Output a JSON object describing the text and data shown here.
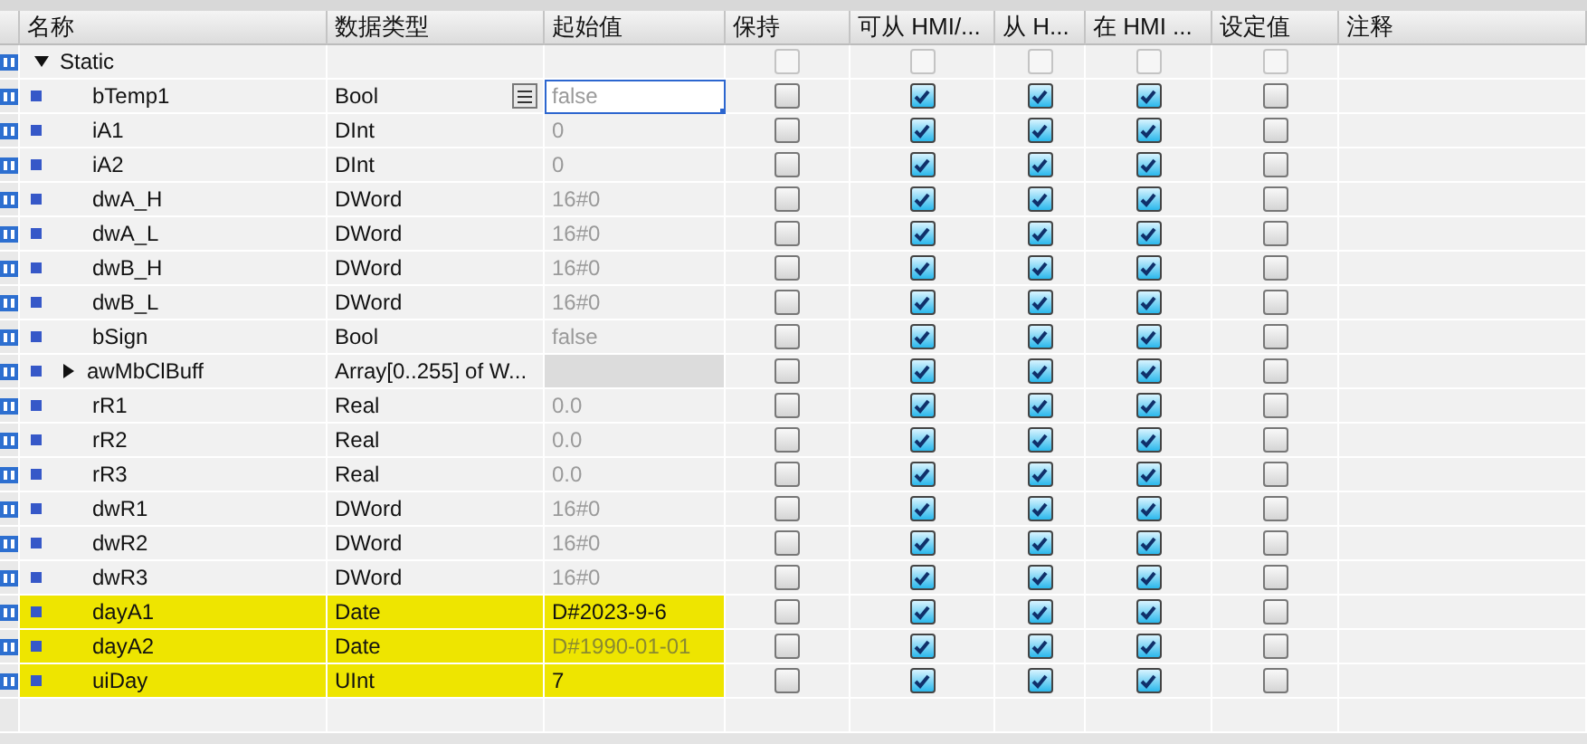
{
  "columns": [
    "名称",
    "数据类型",
    "起始值",
    "保持",
    "可从 HMI/...",
    "从 H...",
    "在 HMI ...",
    "设定值",
    "注释"
  ],
  "rows": [
    {
      "kind": "struct",
      "name": "Static",
      "expanded": true,
      "editing": false,
      "highlighted": false,
      "retain": false,
      "hmi_access": false,
      "hmi_write": false,
      "hmi_visible": false,
      "setpoint": false,
      "disabled": true
    },
    {
      "kind": "var",
      "name": "bTemp1",
      "type": "Bool",
      "start": "false",
      "modified": false,
      "editing": true,
      "highlighted": false,
      "retain": false,
      "hmi_access": true,
      "hmi_write": true,
      "hmi_visible": true,
      "setpoint": false,
      "disabled": false
    },
    {
      "kind": "var",
      "name": "iA1",
      "type": "DInt",
      "start": "0",
      "modified": false,
      "editing": false,
      "highlighted": false,
      "retain": false,
      "hmi_access": true,
      "hmi_write": true,
      "hmi_visible": true,
      "setpoint": false,
      "disabled": false
    },
    {
      "kind": "var",
      "name": "iA2",
      "type": "DInt",
      "start": "0",
      "modified": false,
      "editing": false,
      "highlighted": false,
      "retain": false,
      "hmi_access": true,
      "hmi_write": true,
      "hmi_visible": true,
      "setpoint": false,
      "disabled": false
    },
    {
      "kind": "var",
      "name": "dwA_H",
      "type": "DWord",
      "start": "16#0",
      "modified": false,
      "editing": false,
      "highlighted": false,
      "retain": false,
      "hmi_access": true,
      "hmi_write": true,
      "hmi_visible": true,
      "setpoint": false,
      "disabled": false
    },
    {
      "kind": "var",
      "name": "dwA_L",
      "type": "DWord",
      "start": "16#0",
      "modified": false,
      "editing": false,
      "highlighted": false,
      "retain": false,
      "hmi_access": true,
      "hmi_write": true,
      "hmi_visible": true,
      "setpoint": false,
      "disabled": false
    },
    {
      "kind": "var",
      "name": "dwB_H",
      "type": "DWord",
      "start": "16#0",
      "modified": false,
      "editing": false,
      "highlighted": false,
      "retain": false,
      "hmi_access": true,
      "hmi_write": true,
      "hmi_visible": true,
      "setpoint": false,
      "disabled": false
    },
    {
      "kind": "var",
      "name": "dwB_L",
      "type": "DWord",
      "start": "16#0",
      "modified": false,
      "editing": false,
      "highlighted": false,
      "retain": false,
      "hmi_access": true,
      "hmi_write": true,
      "hmi_visible": true,
      "setpoint": false,
      "disabled": false
    },
    {
      "kind": "var",
      "name": "bSign",
      "type": "Bool",
      "start": "false",
      "modified": false,
      "editing": false,
      "highlighted": false,
      "retain": false,
      "hmi_access": true,
      "hmi_write": true,
      "hmi_visible": true,
      "setpoint": false,
      "disabled": false
    },
    {
      "kind": "array",
      "name": "awMbClBuff",
      "type": "Array[0..255] of W...",
      "expanded": false,
      "editing": false,
      "highlighted": false,
      "retain": false,
      "hmi_access": true,
      "hmi_write": true,
      "hmi_visible": true,
      "setpoint": false,
      "disabled": false
    },
    {
      "kind": "var",
      "name": "rR1",
      "type": "Real",
      "start": "0.0",
      "modified": false,
      "editing": false,
      "highlighted": false,
      "retain": false,
      "hmi_access": true,
      "hmi_write": true,
      "hmi_visible": true,
      "setpoint": false,
      "disabled": false
    },
    {
      "kind": "var",
      "name": "rR2",
      "type": "Real",
      "start": "0.0",
      "modified": false,
      "editing": false,
      "highlighted": false,
      "retain": false,
      "hmi_access": true,
      "hmi_write": true,
      "hmi_visible": true,
      "setpoint": false,
      "disabled": false
    },
    {
      "kind": "var",
      "name": "rR3",
      "type": "Real",
      "start": "0.0",
      "modified": false,
      "editing": false,
      "highlighted": false,
      "retain": false,
      "hmi_access": true,
      "hmi_write": true,
      "hmi_visible": true,
      "setpoint": false,
      "disabled": false
    },
    {
      "kind": "var",
      "name": "dwR1",
      "type": "DWord",
      "start": "16#0",
      "modified": false,
      "editing": false,
      "highlighted": false,
      "retain": false,
      "hmi_access": true,
      "hmi_write": true,
      "hmi_visible": true,
      "setpoint": false,
      "disabled": false
    },
    {
      "kind": "var",
      "name": "dwR2",
      "type": "DWord",
      "start": "16#0",
      "modified": false,
      "editing": false,
      "highlighted": false,
      "retain": false,
      "hmi_access": true,
      "hmi_write": true,
      "hmi_visible": true,
      "setpoint": false,
      "disabled": false
    },
    {
      "kind": "var",
      "name": "dwR3",
      "type": "DWord",
      "start": "16#0",
      "modified": false,
      "editing": false,
      "highlighted": false,
      "retain": false,
      "hmi_access": true,
      "hmi_write": true,
      "hmi_visible": true,
      "setpoint": false,
      "disabled": false
    },
    {
      "kind": "var",
      "name": "dayA1",
      "type": "Date",
      "start": "D#2023-9-6",
      "modified": true,
      "editing": false,
      "highlighted": true,
      "retain": false,
      "hmi_access": true,
      "hmi_write": true,
      "hmi_visible": true,
      "setpoint": false,
      "disabled": false
    },
    {
      "kind": "var",
      "name": "dayA2",
      "type": "Date",
      "start": "D#1990-01-01",
      "modified": false,
      "editing": false,
      "highlighted": true,
      "retain": false,
      "hmi_access": true,
      "hmi_write": true,
      "hmi_visible": true,
      "setpoint": false,
      "disabled": false
    },
    {
      "kind": "var",
      "name": "uiDay",
      "type": "UInt",
      "start": "7",
      "modified": true,
      "editing": false,
      "highlighted": true,
      "retain": false,
      "hmi_access": true,
      "hmi_write": true,
      "hmi_visible": true,
      "setpoint": false,
      "disabled": false
    }
  ]
}
